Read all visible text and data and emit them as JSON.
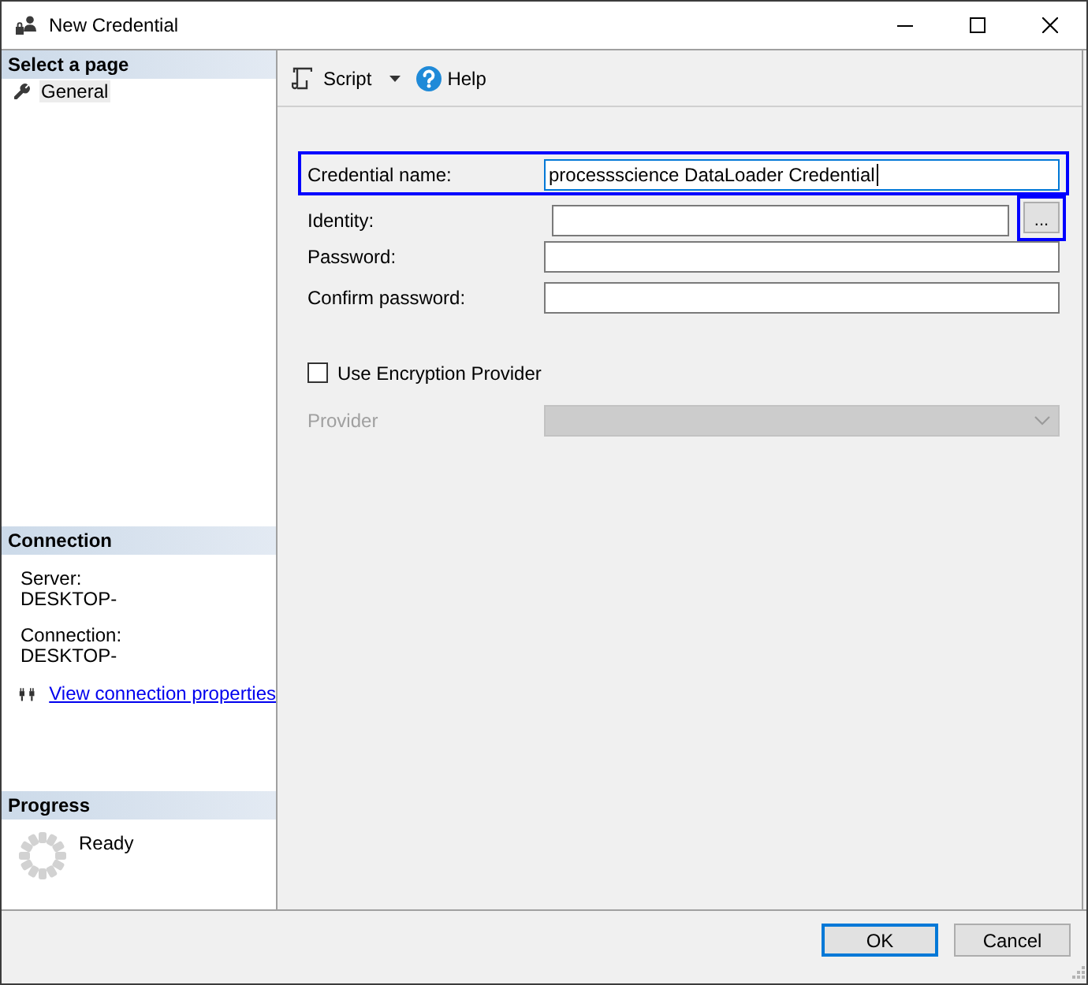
{
  "window": {
    "title": "New Credential"
  },
  "page_selector": {
    "heading": "Select a page",
    "items": [
      {
        "label": "General",
        "selected": true
      }
    ]
  },
  "connection": {
    "heading": "Connection",
    "details": [
      {
        "label": "Server:",
        "value": "DESKTOP-"
      },
      {
        "label": "Connection:",
        "value": "DESKTOP-"
      }
    ],
    "link": "View connection properties"
  },
  "progress": {
    "heading": "Progress",
    "status": "Ready"
  },
  "toolbar": {
    "items": [
      {
        "kind": "script",
        "label": "Script"
      },
      {
        "kind": "help",
        "label": "Help"
      }
    ]
  },
  "form": {
    "fields": [
      {
        "kind": "text",
        "label": "Credential name:",
        "value": "processscience DataLoader Credential",
        "focused": true,
        "highlighted": true
      },
      {
        "kind": "browse",
        "label": "Identity:",
        "focused": false,
        "highlighted": false,
        "button": {
          "label": "...",
          "highlighted": true
        }
      },
      {
        "kind": "text",
        "label": "Password:",
        "focused": false,
        "highlighted": false
      },
      {
        "kind": "text",
        "label": "Confirm password:",
        "focused": false,
        "highlighted": false
      }
    ],
    "encryption": {
      "label": "Use Encryption Provider",
      "checked": false
    },
    "provider": {
      "label": "Provider",
      "disabled": true
    }
  },
  "buttons": [
    {
      "label": "OK",
      "default": true
    },
    {
      "label": "Cancel",
      "default": false
    }
  ]
}
